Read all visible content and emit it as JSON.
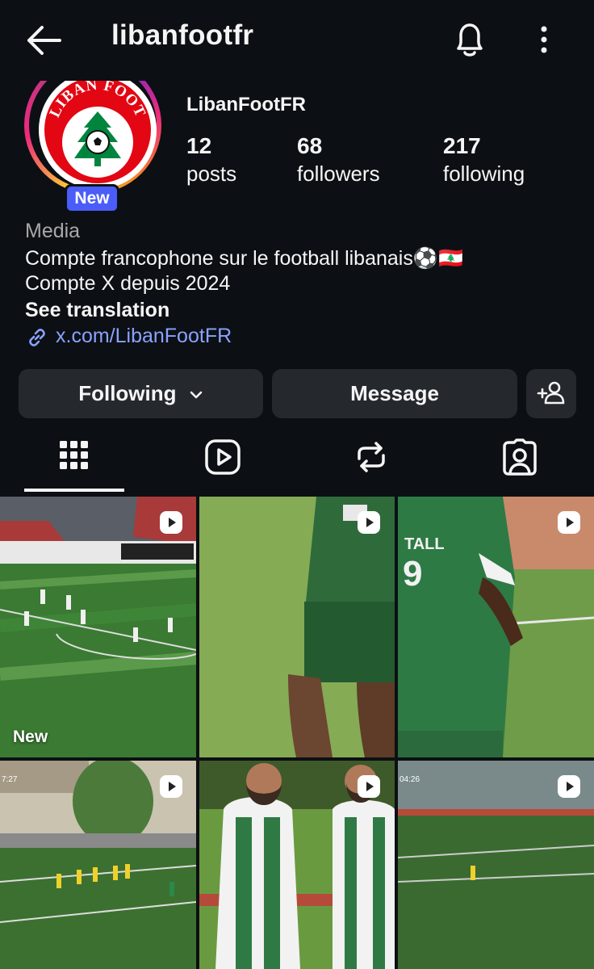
{
  "header": {
    "username": "libanfootfr",
    "icons": [
      "back-arrow-icon",
      "bell-icon",
      "more-vertical-icon"
    ]
  },
  "profile": {
    "name": "LibanFootFR",
    "badge": "New",
    "avatar_logo_text": "LIBAN FOOT",
    "stats": [
      {
        "value": "12",
        "label": "posts"
      },
      {
        "value": "68",
        "label": "followers"
      },
      {
        "value": "217",
        "label": "following"
      }
    ],
    "category": "Media",
    "bio_line1": "Compte francophone sur le football libanais⚽🇱🇧",
    "bio_line2": "Compte X depuis 2024",
    "see_translation": "See translation",
    "link": "x.com/LibanFootFR"
  },
  "actions": {
    "following_label": "Following",
    "message_label": "Message"
  },
  "tabs": [
    "posts-grid-icon",
    "reels-icon",
    "reposts-icon",
    "tagged-icon"
  ],
  "grid": {
    "new_label": "New",
    "timestamps": [
      "7:27",
      "04:26"
    ]
  },
  "colors": {
    "background": "#0c1014",
    "button": "#25292e",
    "link": "#8aa2ff",
    "badge": "#4a5df9"
  }
}
